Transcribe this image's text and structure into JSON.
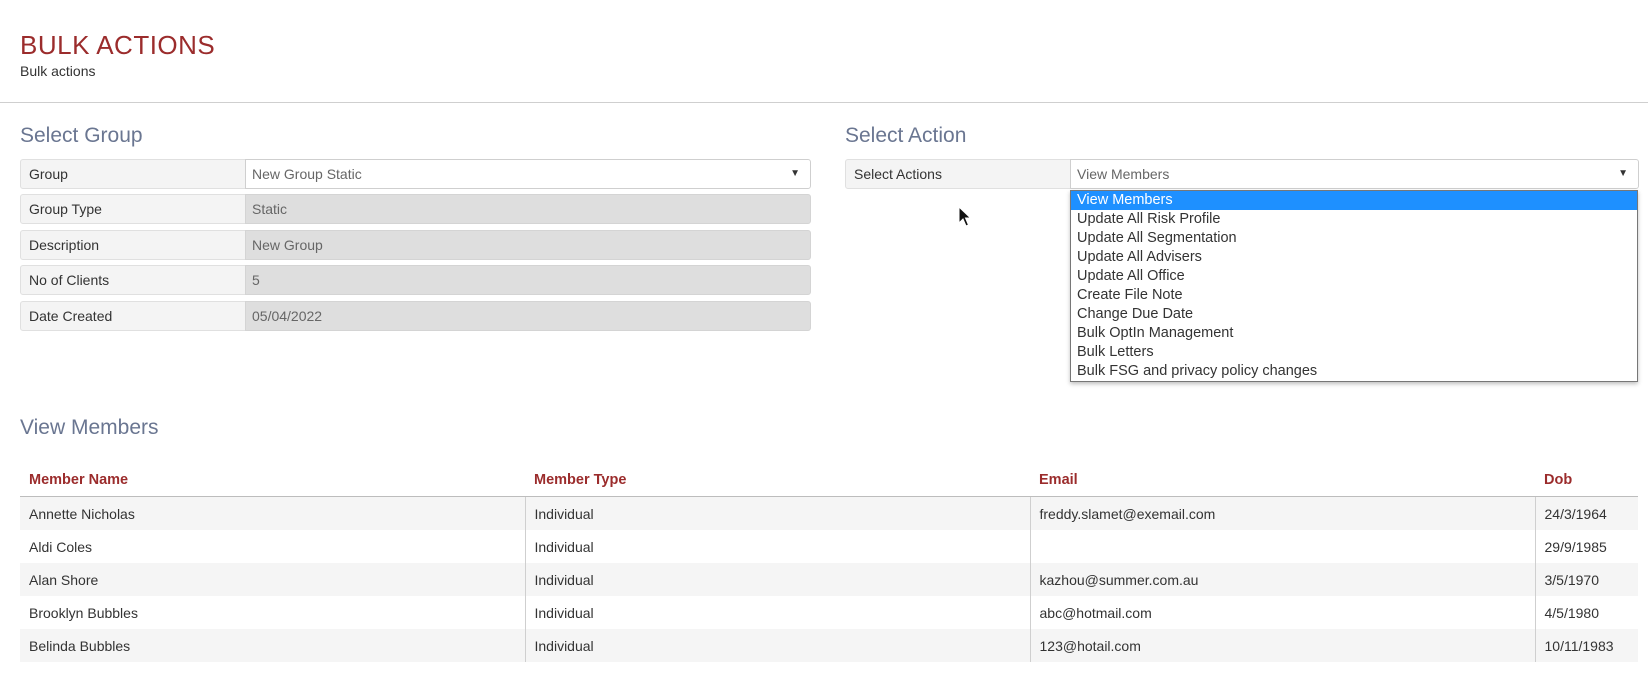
{
  "header": {
    "title": "BULK ACTIONS",
    "subtitle": "Bulk actions"
  },
  "select_group": {
    "title": "Select Group",
    "fields": [
      {
        "label": "Group",
        "value": "New Group Static"
      },
      {
        "label": "Group Type",
        "value": "Static"
      },
      {
        "label": "Description",
        "value": "New Group"
      },
      {
        "label": "No of Clients",
        "value": "5"
      },
      {
        "label": "Date Created",
        "value": "05/04/2022"
      }
    ]
  },
  "select_action": {
    "title": "Select Action",
    "label": "Select Actions",
    "value": "View Members",
    "options": [
      "View Members",
      "Update All Risk Profile",
      "Update All Segmentation",
      "Update All Advisers",
      "Update All Office",
      "Create File Note",
      "Change Due Date",
      "Bulk OptIn Management",
      "Bulk Letters",
      "Bulk FSG and privacy policy changes"
    ]
  },
  "view_members": {
    "title": "View Members",
    "columns": [
      "Member Name",
      "Member Type",
      "Email",
      "Dob"
    ],
    "rows": [
      [
        "Annette Nicholas",
        "Individual",
        "freddy.slamet@exemail.com",
        "24/3/1964"
      ],
      [
        "Aldi Coles",
        "Individual",
        "",
        "29/9/1985"
      ],
      [
        "Alan Shore",
        "Individual",
        "kazhou@summer.com.au",
        "3/5/1970"
      ],
      [
        "Brooklyn Bubbles",
        "Individual",
        "abc@hotmail.com",
        "4/5/1980"
      ],
      [
        "Belinda Bubbles",
        "Individual",
        "123@hotail.com",
        "10/11/1983"
      ]
    ]
  },
  "colors": {
    "accent": "#9b2c2c",
    "section_title": "#6a7691",
    "selected_option": "#1e90ff"
  }
}
